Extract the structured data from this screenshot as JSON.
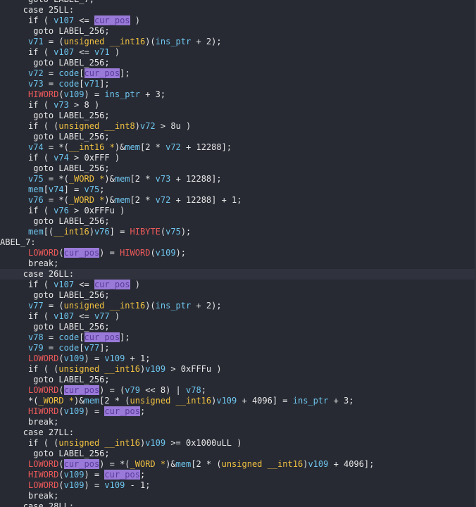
{
  "editor": {
    "highlight_word": "cur_pos",
    "lines": [
      {
        "indent": 10,
        "t": [
          [
            "kw",
            "goto "
          ],
          [
            "lbl",
            "LABEL_7;"
          ]
        ]
      },
      {
        "indent": 8,
        "t": [
          [
            "kw",
            "case "
          ],
          [
            "num",
            "25LL"
          ],
          [
            "op",
            ":"
          ]
        ]
      },
      {
        "indent": 10,
        "t": [
          [
            "kw",
            "if "
          ],
          [
            "op",
            "( "
          ],
          [
            "var",
            "v107"
          ],
          [
            "op",
            " <= "
          ],
          [
            "hl",
            "cur_pos"
          ],
          [
            "op",
            " )"
          ]
        ]
      },
      {
        "indent": 12,
        "t": [
          [
            "kw",
            "goto "
          ],
          [
            "lbl",
            "LABEL_256;"
          ]
        ]
      },
      {
        "indent": 10,
        "t": [
          [
            "var",
            "v71"
          ],
          [
            "op",
            " = ("
          ],
          [
            "typ",
            "unsigned __int16"
          ],
          [
            "op",
            ")("
          ],
          [
            "var",
            "ins_ptr"
          ],
          [
            "op",
            " + 2);"
          ]
        ]
      },
      {
        "indent": 10,
        "t": [
          [
            "kw",
            "if "
          ],
          [
            "op",
            "( "
          ],
          [
            "var",
            "v107"
          ],
          [
            "op",
            " <= "
          ],
          [
            "var",
            "v71"
          ],
          [
            "op",
            " )"
          ]
        ]
      },
      {
        "indent": 12,
        "t": [
          [
            "kw",
            "goto "
          ],
          [
            "lbl",
            "LABEL_256;"
          ]
        ]
      },
      {
        "indent": 10,
        "t": [
          [
            "var",
            "v72"
          ],
          [
            "op",
            " = "
          ],
          [
            "var",
            "code"
          ],
          [
            "op",
            "["
          ],
          [
            "hl",
            "cur_pos"
          ],
          [
            "op",
            "];"
          ]
        ]
      },
      {
        "indent": 10,
        "t": [
          [
            "var",
            "v73"
          ],
          [
            "op",
            " = "
          ],
          [
            "var",
            "code"
          ],
          [
            "op",
            "["
          ],
          [
            "var",
            "v71"
          ],
          [
            "op",
            "];"
          ]
        ]
      },
      {
        "indent": 10,
        "t": [
          [
            "mac",
            "HIWORD"
          ],
          [
            "op",
            "("
          ],
          [
            "var",
            "v109"
          ],
          [
            "op",
            ") = "
          ],
          [
            "var",
            "ins_ptr"
          ],
          [
            "op",
            " + 3;"
          ]
        ]
      },
      {
        "indent": 10,
        "t": [
          [
            "kw",
            "if "
          ],
          [
            "op",
            "( "
          ],
          [
            "var",
            "v73"
          ],
          [
            "op",
            " > 8 )"
          ]
        ]
      },
      {
        "indent": 12,
        "t": [
          [
            "kw",
            "goto "
          ],
          [
            "lbl",
            "LABEL_256;"
          ]
        ]
      },
      {
        "indent": 10,
        "t": [
          [
            "kw",
            "if "
          ],
          [
            "op",
            "( ("
          ],
          [
            "typ",
            "unsigned __int8"
          ],
          [
            "op",
            ")"
          ],
          [
            "var",
            "v72"
          ],
          [
            "op",
            " > 8u )"
          ]
        ]
      },
      {
        "indent": 12,
        "t": [
          [
            "kw",
            "goto "
          ],
          [
            "lbl",
            "LABEL_256;"
          ]
        ]
      },
      {
        "indent": 10,
        "t": [
          [
            "var",
            "v74"
          ],
          [
            "op",
            " = *("
          ],
          [
            "typ",
            "__int16 *"
          ],
          [
            "op",
            ")&"
          ],
          [
            "var",
            "mem"
          ],
          [
            "op",
            "[2 * "
          ],
          [
            "var",
            "v72"
          ],
          [
            "op",
            " + 12288];"
          ]
        ]
      },
      {
        "indent": 10,
        "t": [
          [
            "kw",
            "if "
          ],
          [
            "op",
            "( "
          ],
          [
            "var",
            "v74"
          ],
          [
            "op",
            " > 0xFFF )"
          ]
        ]
      },
      {
        "indent": 12,
        "t": [
          [
            "kw",
            "goto "
          ],
          [
            "lbl",
            "LABEL_256;"
          ]
        ]
      },
      {
        "indent": 10,
        "t": [
          [
            "var",
            "v75"
          ],
          [
            "op",
            " = *("
          ],
          [
            "typ",
            "_WORD *"
          ],
          [
            "op",
            ")&"
          ],
          [
            "var",
            "mem"
          ],
          [
            "op",
            "[2 * "
          ],
          [
            "var",
            "v73"
          ],
          [
            "op",
            " + 12288];"
          ]
        ]
      },
      {
        "indent": 10,
        "t": [
          [
            "var",
            "mem"
          ],
          [
            "op",
            "["
          ],
          [
            "var",
            "v74"
          ],
          [
            "op",
            "] = "
          ],
          [
            "var",
            "v75"
          ],
          [
            "op",
            ";"
          ]
        ]
      },
      {
        "indent": 10,
        "t": [
          [
            "var",
            "v76"
          ],
          [
            "op",
            " = *("
          ],
          [
            "typ",
            "_WORD *"
          ],
          [
            "op",
            ")&"
          ],
          [
            "var",
            "mem"
          ],
          [
            "op",
            "[2 * "
          ],
          [
            "var",
            "v72"
          ],
          [
            "op",
            " + 12288] + 1;"
          ]
        ]
      },
      {
        "indent": 10,
        "t": [
          [
            "kw",
            "if "
          ],
          [
            "op",
            "( "
          ],
          [
            "var",
            "v76"
          ],
          [
            "op",
            " > 0xFFFu )"
          ]
        ]
      },
      {
        "indent": 12,
        "t": [
          [
            "kw",
            "goto "
          ],
          [
            "lbl",
            "LABEL_256;"
          ]
        ]
      },
      {
        "indent": 10,
        "t": [
          [
            "var",
            "mem"
          ],
          [
            "op",
            "[("
          ],
          [
            "typ",
            "__int16"
          ],
          [
            "op",
            ")"
          ],
          [
            "var",
            "v76"
          ],
          [
            "op",
            "] = "
          ],
          [
            "mac",
            "HIBYTE"
          ],
          [
            "op",
            "("
          ],
          [
            "var",
            "v75"
          ],
          [
            "op",
            ");"
          ]
        ]
      },
      {
        "indent": 0,
        "t": [
          [
            "lbl",
            "ABEL_7:"
          ]
        ]
      },
      {
        "indent": 10,
        "t": [
          [
            "mac",
            "LOWORD"
          ],
          [
            "op",
            "("
          ],
          [
            "hl",
            "cur_pos"
          ],
          [
            "op",
            ") = "
          ],
          [
            "mac",
            "HIWORD"
          ],
          [
            "op",
            "("
          ],
          [
            "var",
            "v109"
          ],
          [
            "op",
            ");"
          ]
        ]
      },
      {
        "indent": 10,
        "t": [
          [
            "kw",
            "break;"
          ]
        ]
      },
      {
        "indent": 8,
        "current": true,
        "t": [
          [
            "kw",
            "case "
          ],
          [
            "num",
            "26LL"
          ],
          [
            "op",
            ":"
          ]
        ]
      },
      {
        "indent": 10,
        "t": [
          [
            "kw",
            "if "
          ],
          [
            "op",
            "( "
          ],
          [
            "var",
            "v107"
          ],
          [
            "op",
            " <= "
          ],
          [
            "hl",
            "cur_pos"
          ],
          [
            "op",
            " )"
          ]
        ]
      },
      {
        "indent": 12,
        "t": [
          [
            "kw",
            "goto "
          ],
          [
            "lbl",
            "LABEL_256;"
          ]
        ]
      },
      {
        "indent": 10,
        "t": [
          [
            "var",
            "v77"
          ],
          [
            "op",
            " = ("
          ],
          [
            "typ",
            "unsigned __int16"
          ],
          [
            "op",
            ")("
          ],
          [
            "var",
            "ins_ptr"
          ],
          [
            "op",
            " + 2);"
          ]
        ]
      },
      {
        "indent": 10,
        "t": [
          [
            "kw",
            "if "
          ],
          [
            "op",
            "( "
          ],
          [
            "var",
            "v107"
          ],
          [
            "op",
            " <= "
          ],
          [
            "var",
            "v77"
          ],
          [
            "op",
            " )"
          ]
        ]
      },
      {
        "indent": 12,
        "t": [
          [
            "kw",
            "goto "
          ],
          [
            "lbl",
            "LABEL_256;"
          ]
        ]
      },
      {
        "indent": 10,
        "t": [
          [
            "var",
            "v78"
          ],
          [
            "op",
            " = "
          ],
          [
            "var",
            "code"
          ],
          [
            "op",
            "["
          ],
          [
            "hl",
            "cur_pos"
          ],
          [
            "op",
            "];"
          ]
        ]
      },
      {
        "indent": 10,
        "t": [
          [
            "var",
            "v79"
          ],
          [
            "op",
            " = "
          ],
          [
            "var",
            "code"
          ],
          [
            "op",
            "["
          ],
          [
            "var",
            "v77"
          ],
          [
            "op",
            "];"
          ]
        ]
      },
      {
        "indent": 10,
        "t": [
          [
            "mac",
            "LOWORD"
          ],
          [
            "op",
            "("
          ],
          [
            "var",
            "v109"
          ],
          [
            "op",
            ") = "
          ],
          [
            "var",
            "v109"
          ],
          [
            "op",
            " + 1;"
          ]
        ]
      },
      {
        "indent": 10,
        "t": [
          [
            "kw",
            "if "
          ],
          [
            "op",
            "( ("
          ],
          [
            "typ",
            "unsigned __int16"
          ],
          [
            "op",
            ")"
          ],
          [
            "var",
            "v109"
          ],
          [
            "op",
            " > 0xFFFu )"
          ]
        ]
      },
      {
        "indent": 12,
        "t": [
          [
            "kw",
            "goto "
          ],
          [
            "lbl",
            "LABEL_256;"
          ]
        ]
      },
      {
        "indent": 10,
        "t": [
          [
            "mac",
            "LOWORD"
          ],
          [
            "op",
            "("
          ],
          [
            "hl",
            "cur_pos"
          ],
          [
            "op",
            ") = ("
          ],
          [
            "var",
            "v79"
          ],
          [
            "op",
            " << 8) | "
          ],
          [
            "var",
            "v78"
          ],
          [
            "op",
            ";"
          ]
        ]
      },
      {
        "indent": 10,
        "t": [
          [
            "op",
            "*("
          ],
          [
            "typ",
            "_WORD *"
          ],
          [
            "op",
            ")&"
          ],
          [
            "var",
            "mem"
          ],
          [
            "op",
            "[2 * ("
          ],
          [
            "typ",
            "unsigned __int16"
          ],
          [
            "op",
            ")"
          ],
          [
            "var",
            "v109"
          ],
          [
            "op",
            " + 4096] = "
          ],
          [
            "var",
            "ins_ptr"
          ],
          [
            "op",
            " + 3;"
          ]
        ]
      },
      {
        "indent": 10,
        "t": [
          [
            "mac",
            "HIWORD"
          ],
          [
            "op",
            "("
          ],
          [
            "var",
            "v109"
          ],
          [
            "op",
            ") = "
          ],
          [
            "hl",
            "cur_pos"
          ],
          [
            "op",
            ";"
          ]
        ]
      },
      {
        "indent": 10,
        "t": [
          [
            "kw",
            "break;"
          ]
        ]
      },
      {
        "indent": 8,
        "t": [
          [
            "kw",
            "case "
          ],
          [
            "num",
            "27LL"
          ],
          [
            "op",
            ":"
          ]
        ]
      },
      {
        "indent": 10,
        "t": [
          [
            "kw",
            "if "
          ],
          [
            "op",
            "( ("
          ],
          [
            "typ",
            "unsigned __int16"
          ],
          [
            "op",
            ")"
          ],
          [
            "var",
            "v109"
          ],
          [
            "op",
            " >= 0x1000uLL )"
          ]
        ]
      },
      {
        "indent": 12,
        "t": [
          [
            "kw",
            "goto "
          ],
          [
            "lbl",
            "LABEL_256;"
          ]
        ]
      },
      {
        "indent": 10,
        "t": [
          [
            "mac",
            "LOWORD"
          ],
          [
            "op",
            "("
          ],
          [
            "hl",
            "cur_pos"
          ],
          [
            "op",
            ") = *("
          ],
          [
            "typ",
            "_WORD *"
          ],
          [
            "op",
            ")&"
          ],
          [
            "var",
            "mem"
          ],
          [
            "op",
            "[2 * ("
          ],
          [
            "typ",
            "unsigned __int16"
          ],
          [
            "op",
            ")"
          ],
          [
            "var",
            "v109"
          ],
          [
            "op",
            " + 4096];"
          ]
        ]
      },
      {
        "indent": 10,
        "t": [
          [
            "mac",
            "HIWORD"
          ],
          [
            "op",
            "("
          ],
          [
            "var",
            "v109"
          ],
          [
            "op",
            ") = "
          ],
          [
            "hl",
            "cur_pos"
          ],
          [
            "op",
            ";"
          ]
        ]
      },
      {
        "indent": 10,
        "t": [
          [
            "mac",
            "LOWORD"
          ],
          [
            "op",
            "("
          ],
          [
            "var",
            "v109"
          ],
          [
            "op",
            ") = "
          ],
          [
            "var",
            "v109"
          ],
          [
            "op",
            " - 1;"
          ]
        ]
      },
      {
        "indent": 10,
        "t": [
          [
            "kw",
            "break;"
          ]
        ]
      },
      {
        "indent": 8,
        "t": [
          [
            "kw",
            "case "
          ],
          [
            "num",
            "28LL"
          ],
          [
            "op",
            ":"
          ]
        ]
      }
    ]
  }
}
